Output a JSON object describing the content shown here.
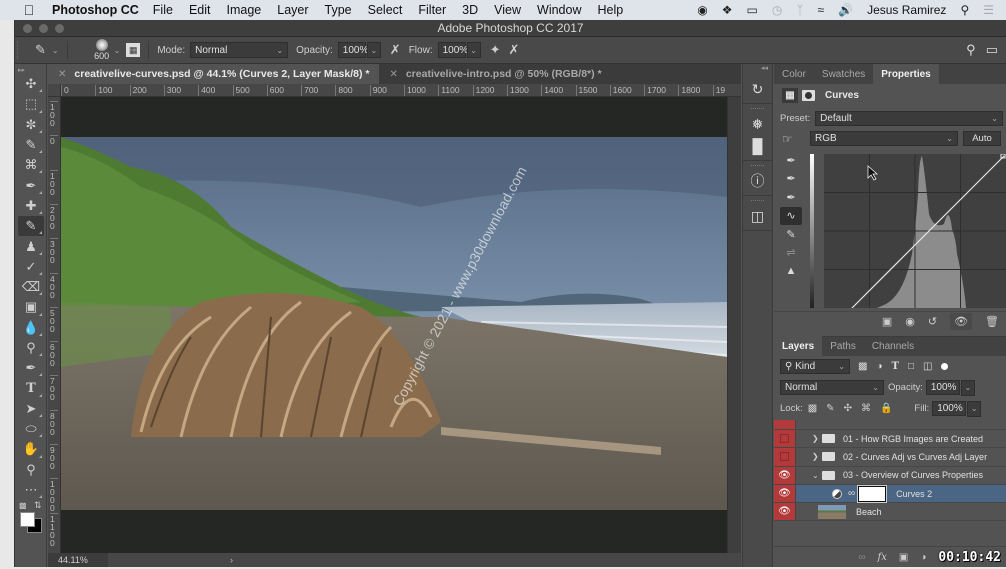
{
  "menubar": {
    "app_name": "Photoshop CC",
    "items": [
      "File",
      "Edit",
      "Image",
      "Layer",
      "Type",
      "Select",
      "Filter",
      "3D",
      "View",
      "Window",
      "Help"
    ],
    "user": "Jesus Ramirez",
    "status_icons": [
      "creative-cloud-icon",
      "dropbox-icon",
      "airplay-icon",
      "time-machine-icon",
      "bluetooth-icon",
      "wifi-icon",
      "volume-icon"
    ]
  },
  "window": {
    "title": "Adobe Photoshop CC 2017"
  },
  "options_bar": {
    "brush_size": "600",
    "mode_label": "Mode:",
    "mode_value": "Normal",
    "opacity_label": "Opacity:",
    "opacity_value": "100%",
    "flow_label": "Flow:",
    "flow_value": "100%"
  },
  "tabs": [
    {
      "label": "creativelive-curves.psd @ 44.1% (Curves 2, Layer Mask/8) *",
      "active": true
    },
    {
      "label": "creativelive-intro.psd @ 50% (RGB/8*) *",
      "active": false
    }
  ],
  "ruler": {
    "horizontal": [
      "0",
      "100",
      "200",
      "300",
      "400",
      "500",
      "600",
      "700",
      "800",
      "900",
      "1000",
      "1100",
      "1200",
      "1300",
      "1400",
      "1500",
      "1600",
      "1700",
      "1800",
      "19"
    ],
    "vertical": [
      "100",
      "0",
      "100",
      "200",
      "300",
      "400",
      "500",
      "600",
      "700",
      "800",
      "900",
      "1000",
      "1100"
    ]
  },
  "canvas": {
    "watermark": "Copyright © 2021 - www.p30download.com"
  },
  "status": {
    "zoom": "44.11%",
    "arrow": "›"
  },
  "properties_panel": {
    "tabs": [
      "Color",
      "Swatches",
      "Properties"
    ],
    "active_tab": "Properties",
    "adjustment_name": "Curves",
    "preset_label": "Preset:",
    "preset_value": "Default",
    "channel_value": "RGB",
    "auto_label": "Auto"
  },
  "layers_panel": {
    "tabs": [
      "Layers",
      "Paths",
      "Channels"
    ],
    "active_tab": "Layers",
    "filter_value": "Kind",
    "blend_mode": "Normal",
    "opacity_label": "Opacity:",
    "opacity_value": "100%",
    "lock_label": "Lock:",
    "fill_label": "Fill:",
    "fill_value": "100%",
    "layers": [
      {
        "name": "01 - How RGB Images are Created",
        "type": "group",
        "visible": false,
        "expanded": false
      },
      {
        "name": "02 - Curves Adj vs Curves Adj Layer",
        "type": "group",
        "visible": false,
        "expanded": false
      },
      {
        "name": "03 - Overview of Curves Properties",
        "type": "group",
        "visible": true,
        "expanded": true
      },
      {
        "name": "Curves 2",
        "type": "adjustment",
        "visible": true,
        "selected": true
      },
      {
        "name": "Beach",
        "type": "pixel",
        "visible": true
      }
    ]
  },
  "video": {
    "timecode": "00:10:42"
  },
  "colors": {
    "panel_bg": "#535353",
    "selected_layer": "#4b6584",
    "visibility_column": "#b33a3a"
  }
}
